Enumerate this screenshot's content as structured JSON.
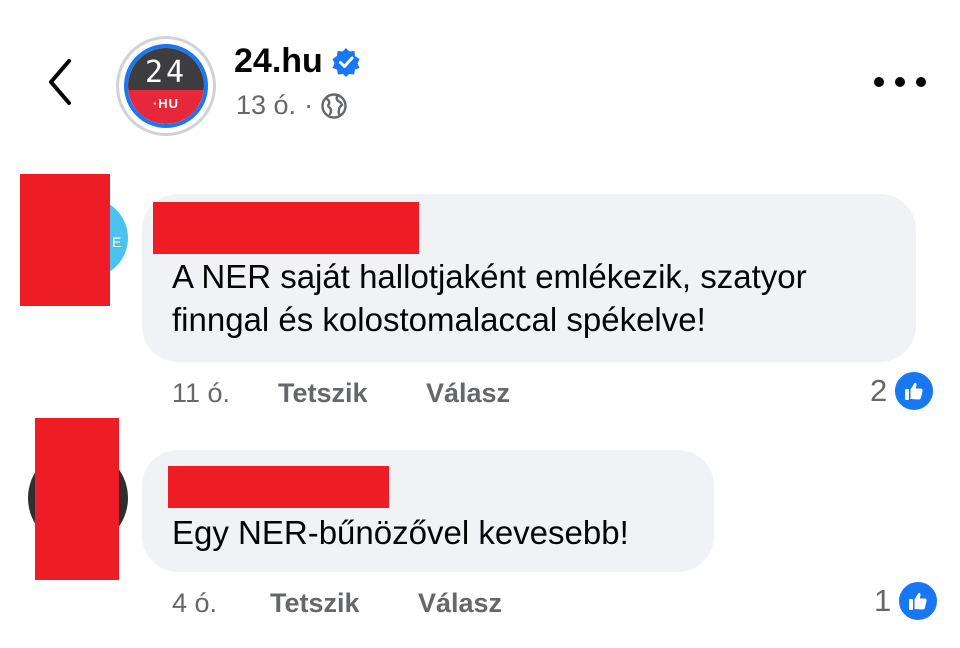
{
  "header": {
    "page_name": "24.hu",
    "time": "13 ó.",
    "separator": "·",
    "icons": {
      "back": "chevron-left-icon",
      "verified": "verified-badge-icon",
      "audience": "globe-icon",
      "more": "more-dots-icon"
    },
    "logo": {
      "top_text": "24",
      "bottom_text": "·HU",
      "top_color": "#3d3d3f",
      "bottom_color": "#e6283a",
      "ring_color": "#1877f2"
    }
  },
  "comments": [
    {
      "text": "A NER saját hallotjaként emlékezik, szatyor finngal és kolostomalaccal spékelve!",
      "time": "11 ó.",
      "like_label": "Tetszik",
      "reply_label": "Válasz",
      "reaction_count": "2",
      "avatar_letter": "E"
    },
    {
      "text": "Egy NER-bűnözővel kevesebb!",
      "time": "4 ó.",
      "like_label": "Tetszik",
      "reply_label": "Válasz",
      "reaction_count": "1"
    }
  ],
  "colors": {
    "redaction": "#ee1c25",
    "bubble": "#f0f2f5",
    "accent": "#1877f2",
    "secondary_text": "#65676b"
  }
}
